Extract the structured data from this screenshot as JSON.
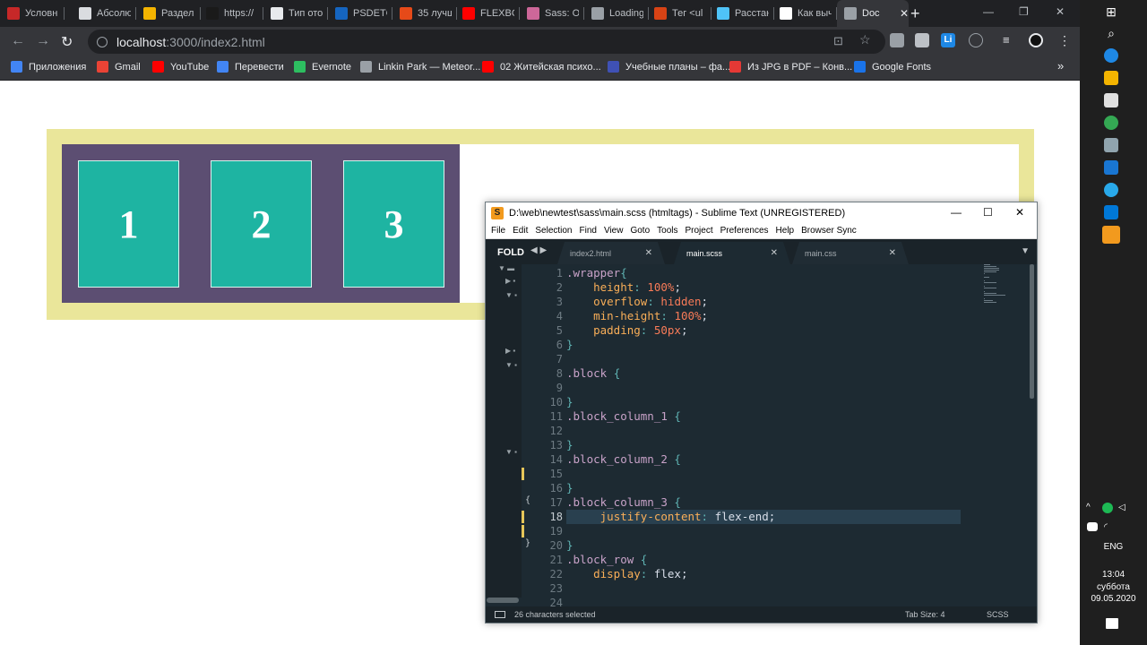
{
  "browser": {
    "tabs": [
      {
        "label": "Условн",
        "color": "#c62828"
      },
      {
        "label": "Абсолю",
        "color": "#dadce0"
      },
      {
        "label": "Раздел",
        "color": "#f4b400"
      },
      {
        "label": "https://",
        "color": "#1a1a1a"
      },
      {
        "label": "Тип ото",
        "color": "#e8eaed"
      },
      {
        "label": "PSDETC",
        "color": "#1565c0"
      },
      {
        "label": "35 лучш",
        "color": "#e64a19"
      },
      {
        "label": "FLEXBO",
        "color": "#ff0000"
      },
      {
        "label": "Sass: Os",
        "color": "#cd6799"
      },
      {
        "label": "Loading",
        "color": "#9aa0a6"
      },
      {
        "label": "Тег <ul",
        "color": "#d84315"
      },
      {
        "label": "Расстан",
        "color": "#4fc3f7"
      },
      {
        "label": "Как выч",
        "color": "#ffffff"
      },
      {
        "label": "Doc",
        "color": "#9aa0a6"
      }
    ],
    "new_tab": "+",
    "window_controls": {
      "minimize": "—",
      "restore": "❐",
      "close": "✕"
    },
    "url_host": "localhost",
    "url_path": ":3000/index2.html",
    "bookmarks": [
      {
        "label": "Приложения",
        "color": "#4285f4"
      },
      {
        "label": "Gmail",
        "color": "#ea4335"
      },
      {
        "label": "YouTube",
        "color": "#ff0000"
      },
      {
        "label": "Перевести",
        "color": "#4285f4"
      },
      {
        "label": "Evernote",
        "color": "#2dbe60"
      },
      {
        "label": "Linkin Park — Meteor...",
        "color": "#9aa0a6"
      },
      {
        "label": "02 Житейская психо...",
        "color": "#ff0000"
      },
      {
        "label": "Учебные планы – фа...",
        "color": "#3f51b5"
      },
      {
        "label": "Из JPG в PDF – Конв...",
        "color": "#e53935"
      },
      {
        "label": "Google Fonts",
        "color": "#1a73e8"
      }
    ],
    "bookmarks_more": "»"
  },
  "page": {
    "blocks": [
      "1",
      "2",
      "3"
    ],
    "colors": {
      "wrapper": "#eae69a",
      "row": "#5c4e72",
      "block": "#1eb4a2"
    }
  },
  "editor": {
    "title": "D:\\web\\newtest\\sass\\main.scss (htmltags) - Sublime Text (UNREGISTERED)",
    "menu": [
      "File",
      "Edit",
      "Selection",
      "Find",
      "View",
      "Goto",
      "Tools",
      "Project",
      "Preferences",
      "Help",
      "Browser Sync"
    ],
    "fold_label": "FOLD",
    "tabs": [
      {
        "label": "index2.html",
        "active": false
      },
      {
        "label": "main.scss",
        "active": true
      },
      {
        "label": "main.css",
        "active": false
      }
    ],
    "code_lines": [
      [
        [
          "k-sel",
          ".wrapper"
        ],
        [
          "k-punc",
          "{"
        ]
      ],
      [
        [
          "k-kw",
          "    "
        ],
        [
          "k-prop",
          "height"
        ],
        [
          "k-colon",
          ": "
        ],
        [
          "k-val",
          "100%"
        ],
        [
          "k-kw",
          ";"
        ]
      ],
      [
        [
          "k-kw",
          "    "
        ],
        [
          "k-prop",
          "overflow"
        ],
        [
          "k-colon",
          ": "
        ],
        [
          "k-val",
          "hidden"
        ],
        [
          "k-kw",
          ";"
        ]
      ],
      [
        [
          "k-kw",
          "    "
        ],
        [
          "k-prop",
          "min-height"
        ],
        [
          "k-colon",
          ": "
        ],
        [
          "k-val",
          "100%"
        ],
        [
          "k-kw",
          ";"
        ]
      ],
      [
        [
          "k-kw",
          "    "
        ],
        [
          "k-prop",
          "padding"
        ],
        [
          "k-colon",
          ": "
        ],
        [
          "k-val",
          "50px"
        ],
        [
          "k-kw",
          ";"
        ]
      ],
      [
        [
          "k-punc",
          "}"
        ]
      ],
      [],
      [
        [
          "k-sel",
          ".block"
        ],
        [
          "k-kw",
          " "
        ],
        [
          "k-punc",
          "{"
        ]
      ],
      [],
      [
        [
          "k-punc",
          "}"
        ]
      ],
      [
        [
          "k-sel",
          ".block_column_1"
        ],
        [
          "k-kw",
          " "
        ],
        [
          "k-punc",
          "{"
        ]
      ],
      [],
      [
        [
          "k-punc",
          "}"
        ]
      ],
      [
        [
          "k-sel",
          ".block_column_2"
        ],
        [
          "k-kw",
          " "
        ],
        [
          "k-punc",
          "{"
        ]
      ],
      [],
      [
        [
          "k-punc",
          "}"
        ]
      ],
      [
        [
          "k-sel",
          ".block_column_3"
        ],
        [
          "k-kw",
          " "
        ],
        [
          "k-punc",
          "{"
        ]
      ],
      [
        [
          "k-kw",
          "     "
        ],
        [
          "k-prop",
          "justify-content"
        ],
        [
          "k-colon",
          ": "
        ],
        [
          "k-kw",
          "flex-end;"
        ]
      ],
      [],
      [
        [
          "k-punc",
          "}"
        ]
      ],
      [
        [
          "k-sel",
          ".block_row"
        ],
        [
          "k-kw",
          " "
        ],
        [
          "k-punc",
          "{"
        ]
      ],
      [
        [
          "k-kw",
          "    "
        ],
        [
          "k-prop",
          "display"
        ],
        [
          "k-colon",
          ": "
        ],
        [
          "k-kw",
          "flex;"
        ]
      ],
      [],
      []
    ],
    "current_line": 18,
    "modified_lines": [
      15,
      18,
      19
    ],
    "status": {
      "selection": "26 characters selected",
      "tab_size": "Tab Size: 4",
      "syntax": "SCSS"
    }
  },
  "taskbar": {
    "language": "ENG",
    "time": "13:04",
    "weekday": "суббота",
    "date": "09.05.2020"
  }
}
